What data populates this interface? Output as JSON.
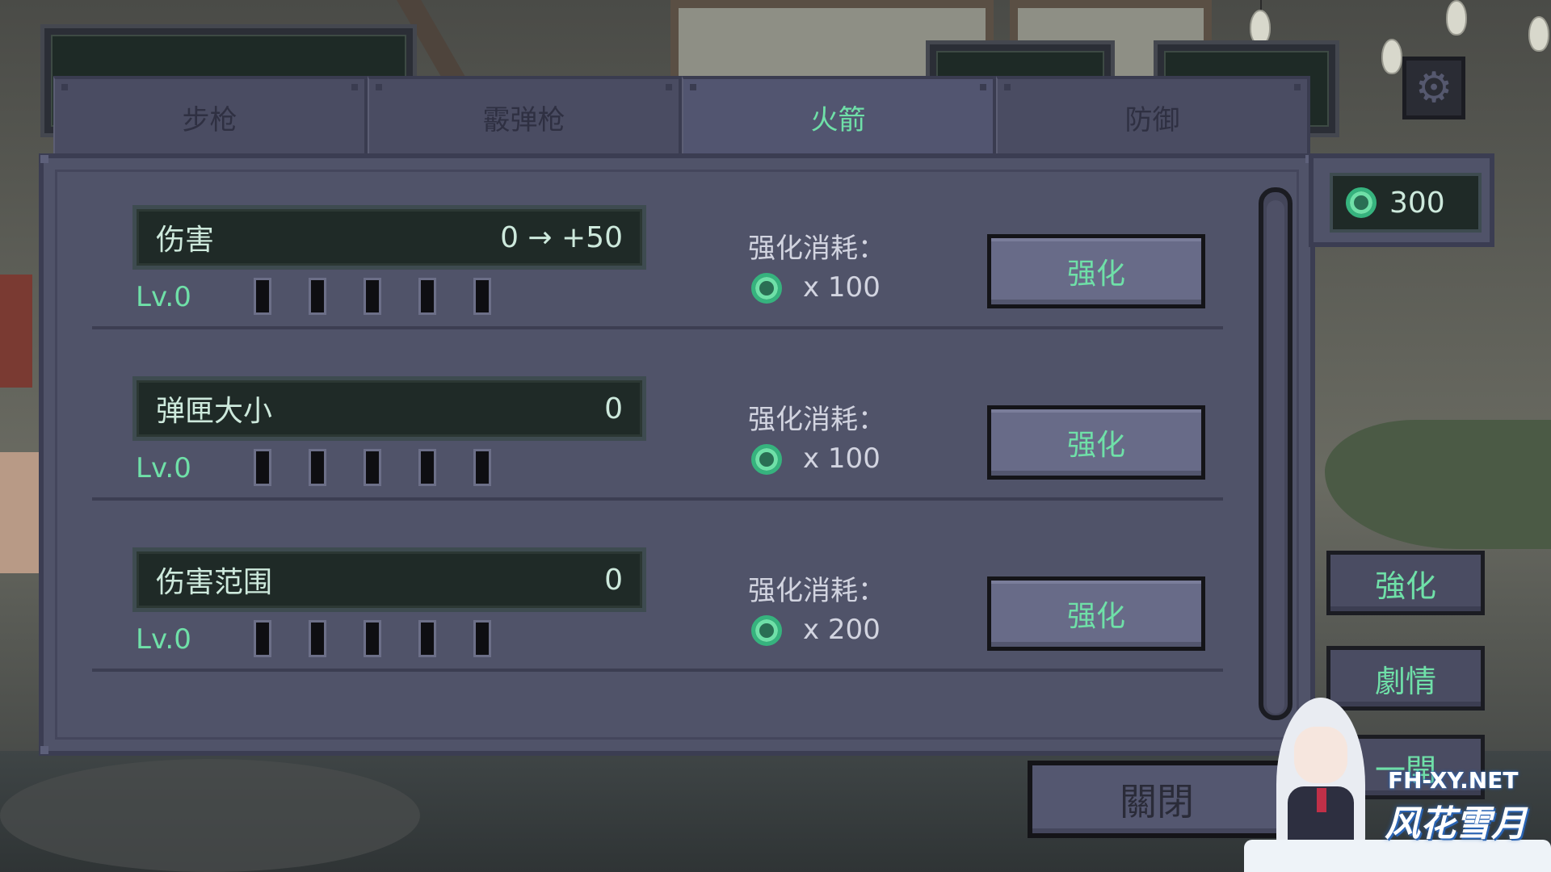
{
  "tabs": [
    {
      "label": "步枪",
      "active": false
    },
    {
      "label": "霰弹枪",
      "active": false
    },
    {
      "label": "火箭",
      "active": true
    },
    {
      "label": "防御",
      "active": false
    }
  ],
  "currency": {
    "icon": "gear-coin-icon",
    "amount": "300"
  },
  "upgrades": [
    {
      "name": "伤害",
      "value": "0 → +50",
      "level": "Lv.0",
      "cost_label": "强化消耗：",
      "cost": "x 100",
      "button": "强化",
      "level_progress": 0,
      "max_level": 5
    },
    {
      "name": "弹匣大小",
      "value": "0",
      "level": "Lv.0",
      "cost_label": "强化消耗：",
      "cost": "x 100",
      "button": "强化",
      "level_progress": 0,
      "max_level": 5
    },
    {
      "name": "伤害范围",
      "value": "0",
      "level": "Lv.0",
      "cost_label": "强化消耗：",
      "cost": "x 200",
      "button": "强化",
      "level_progress": 0,
      "max_level": 5
    }
  ],
  "side_buttons": {
    "upgrade": "強化",
    "story": "劇情",
    "third": "一開"
  },
  "close_button": "關閉",
  "watermark": {
    "line1": "FH-XY.NET",
    "line2": "风花雪月"
  },
  "colors": {
    "accent": "#6fe0a8",
    "panel": "#505369",
    "dark_bar": "#1f2a27",
    "button": "#686b88"
  }
}
